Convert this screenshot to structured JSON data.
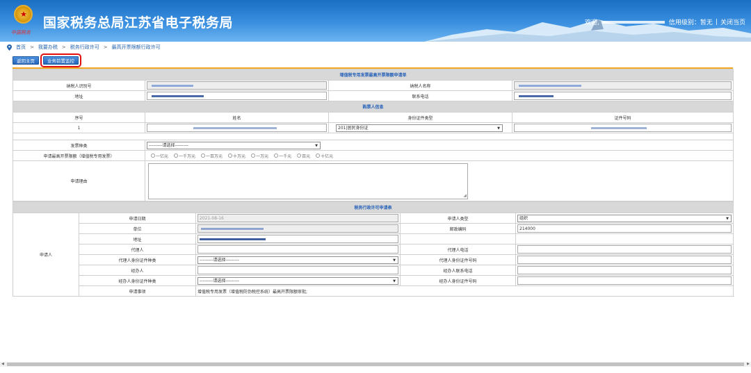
{
  "header": {
    "title": "国家税务总局江苏省电子税务局",
    "logo_sub": "中国税务",
    "welcome": "欢迎,",
    "credit": "信用级别：暂无",
    "close": "关闭当页",
    "separator": "|"
  },
  "breadcrumb": {
    "items": [
      "首页",
      "我要办税",
      "税务行政许可",
      "最高开票限额行政许可"
    ],
    "sep": ">"
  },
  "toolbar": {
    "home": "返回主页",
    "precheck": "业务前置监控"
  },
  "form": {
    "section1": "增值税专用发票最高开票限额申请单",
    "taxpayer_id_label": "纳税人识别号",
    "taxpayer_name_label": "纳税人名称",
    "address_label": "地址",
    "phone_label": "联系电话",
    "buyer_section": "购票人信息",
    "col_no": "序号",
    "col_name": "姓名",
    "col_idtype": "身份证件类型",
    "col_idno": "证件号码",
    "row_no": "1",
    "row_idtype": "201|居民身份证",
    "invoice_type_label": "发票种类",
    "invoice_type_value": "---------请选择---------",
    "limit_label": "申请最高开票限额（增值税专用发票）",
    "limit_options": [
      "一亿元",
      "一千万元",
      "一百万元",
      "十万元",
      "一万元",
      "一千元",
      "百元",
      "十亿元"
    ],
    "reason_label": "申请理由",
    "section2": "税务行政许可申请表",
    "applicant_label": "申请人",
    "apply_date_label": "申请日期",
    "apply_date_value": "2021-08-16",
    "applicant_type_label": "申请人类型",
    "applicant_type_value": "组织",
    "unit_label": "单位",
    "zip_label": "邮政编码",
    "zip_value": "214000",
    "addr2_label": "地址",
    "agent_label": "代理人",
    "agent_phone_label": "代理人电话",
    "agent_idtype_label": "代理人身份证件种类",
    "agent_idtype_value": "---------请选择---------",
    "agent_idno_label": "代理人身份证件号码",
    "handler_label": "经办人",
    "handler_phone_label": "经办人联系电话",
    "handler_idtype_label": "经办人身份证件种类",
    "handler_idtype_value": "---------请选择---------",
    "handler_idno_label": "经办人身份证件号码",
    "matter_label": "申请事项",
    "matter_value": "增值税专用发票（增值税防伪税控系统）最高开票限额审批;"
  },
  "colors": {
    "accent": "#2560b8",
    "header_blue": "#1a6fc4",
    "highlight": "#e01010",
    "topline": "#f0a820"
  }
}
